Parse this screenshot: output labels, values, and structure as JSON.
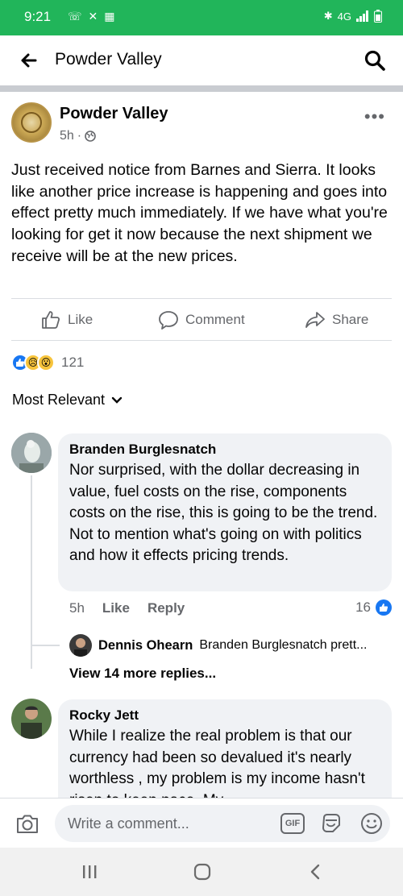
{
  "status_bar": {
    "time": "9:21",
    "network": "4G"
  },
  "app_bar": {
    "title": "Powder Valley"
  },
  "post": {
    "author": "Powder Valley",
    "time": "5h",
    "separator": "·",
    "text": "Just received notice from Barnes and Sierra.  It looks like another price increase is happening and goes into effect pretty much immediately.  If we have what you're looking for get it now because the next shipment we receive will be at the new prices.",
    "actions": {
      "like": "Like",
      "comment": "Comment",
      "share": "Share"
    },
    "reaction_count": "121"
  },
  "sort_label": "Most Relevant",
  "comments": [
    {
      "author": "Branden Burglesnatch",
      "text": "Nor surprised, with the dollar decreasing in value, fuel costs on the rise, components costs on the rise, this is going to be the trend.  Not to mention what's going on with politics and how it effects pricing trends.",
      "time": "5h",
      "like": "Like",
      "reply": "Reply",
      "likes": "16"
    },
    {
      "author": "Rocky Jett",
      "text": "While I realize the real problem is that our currency had been so devalued it's nearly worthless , my problem is my income hasn't risen to keep pace.  My"
    }
  ],
  "reply_preview": {
    "author": "Dennis Ohearn",
    "text": "Branden Burglesnatch prett..."
  },
  "view_more": "View 14 more replies...",
  "composer": {
    "placeholder": "Write a comment...",
    "gif": "GIF"
  },
  "colors": {
    "status_bar": "#21b55a",
    "facebook_blue": "#1877f2",
    "secondary_text": "#65676b"
  }
}
